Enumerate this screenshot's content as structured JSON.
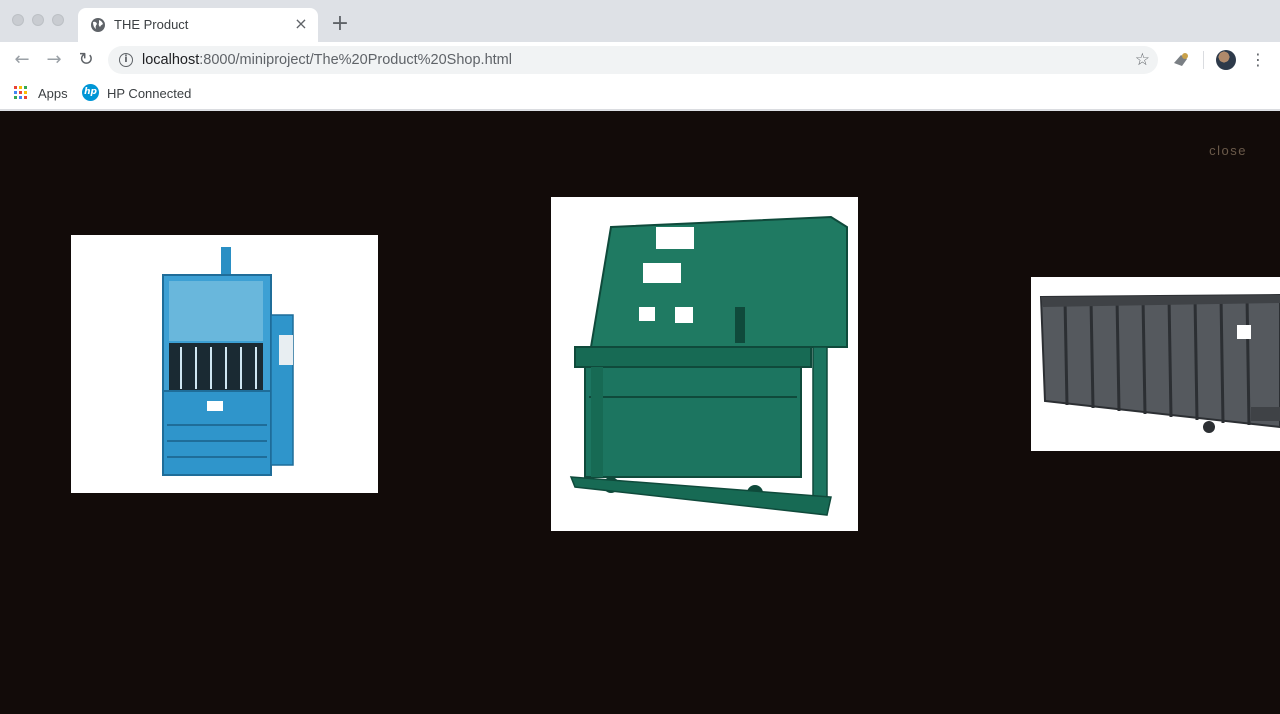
{
  "browser": {
    "tab_title": "THE Product",
    "tab_close": "×",
    "new_tab": "+",
    "url_host": "localhost",
    "url_rest": ":8000/miniproject/The%20Product%20Shop.html",
    "back": "←",
    "forward": "→",
    "reload": "↻",
    "star": "☆",
    "menu": "⋮",
    "info": "i"
  },
  "bookmarks": [
    {
      "label": "Apps",
      "icon": "apps-grid-icon"
    },
    {
      "label": "HP Connected",
      "icon": "hp-logo-icon",
      "logo_text": "hp"
    }
  ],
  "page": {
    "background": "#120b09",
    "close_label": "close",
    "slides": [
      {
        "name": "vertical baler",
        "color": "#2a8fc4"
      },
      {
        "name": "stationary compactor",
        "color": "#1d6e5a"
      },
      {
        "name": "roll-off container",
        "color": "#4a4d52"
      }
    ]
  }
}
